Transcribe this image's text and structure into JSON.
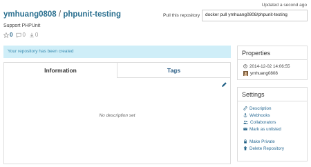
{
  "header": {
    "namespace": "ymhuang0808",
    "separator": "/",
    "repo_name": "phpunit-testing",
    "subtitle": "Support PHPUnit",
    "updated": "Updated a second ago",
    "stats": [
      {
        "icon": "star-icon",
        "value": "0"
      },
      {
        "icon": "comment-icon",
        "value": "0"
      },
      {
        "icon": "download-icon",
        "value": "0"
      }
    ]
  },
  "pull": {
    "label": "Pull this repository",
    "command": "docker pull ymhuang0808/phpunit-testing"
  },
  "alert": {
    "message": "Your repository has been created"
  },
  "tabs": [
    {
      "label": "Information",
      "active": true
    },
    {
      "label": "Tags",
      "active": false
    }
  ],
  "info": {
    "description": "No description set"
  },
  "properties": {
    "title": "Properties",
    "created": "2014-12-02 14:06:55",
    "owner": "ymhuang0808"
  },
  "settings": {
    "title": "Settings",
    "items": [
      {
        "label": "Description",
        "icon": "link-icon"
      },
      {
        "label": "Webhooks",
        "icon": "anchor-icon"
      },
      {
        "label": "Collaborators",
        "icon": "users-icon"
      },
      {
        "label": "Mark as unlisted",
        "icon": "envelope-icon"
      }
    ],
    "items2": [
      {
        "label": "Make Private",
        "icon": "lock-icon"
      },
      {
        "label": "Delete Repository",
        "icon": "trash-icon"
      }
    ]
  },
  "colors": {
    "link": "#2a6f8f",
    "alert_bg": "#cfeef8",
    "alert_text": "#3a8bb0"
  }
}
